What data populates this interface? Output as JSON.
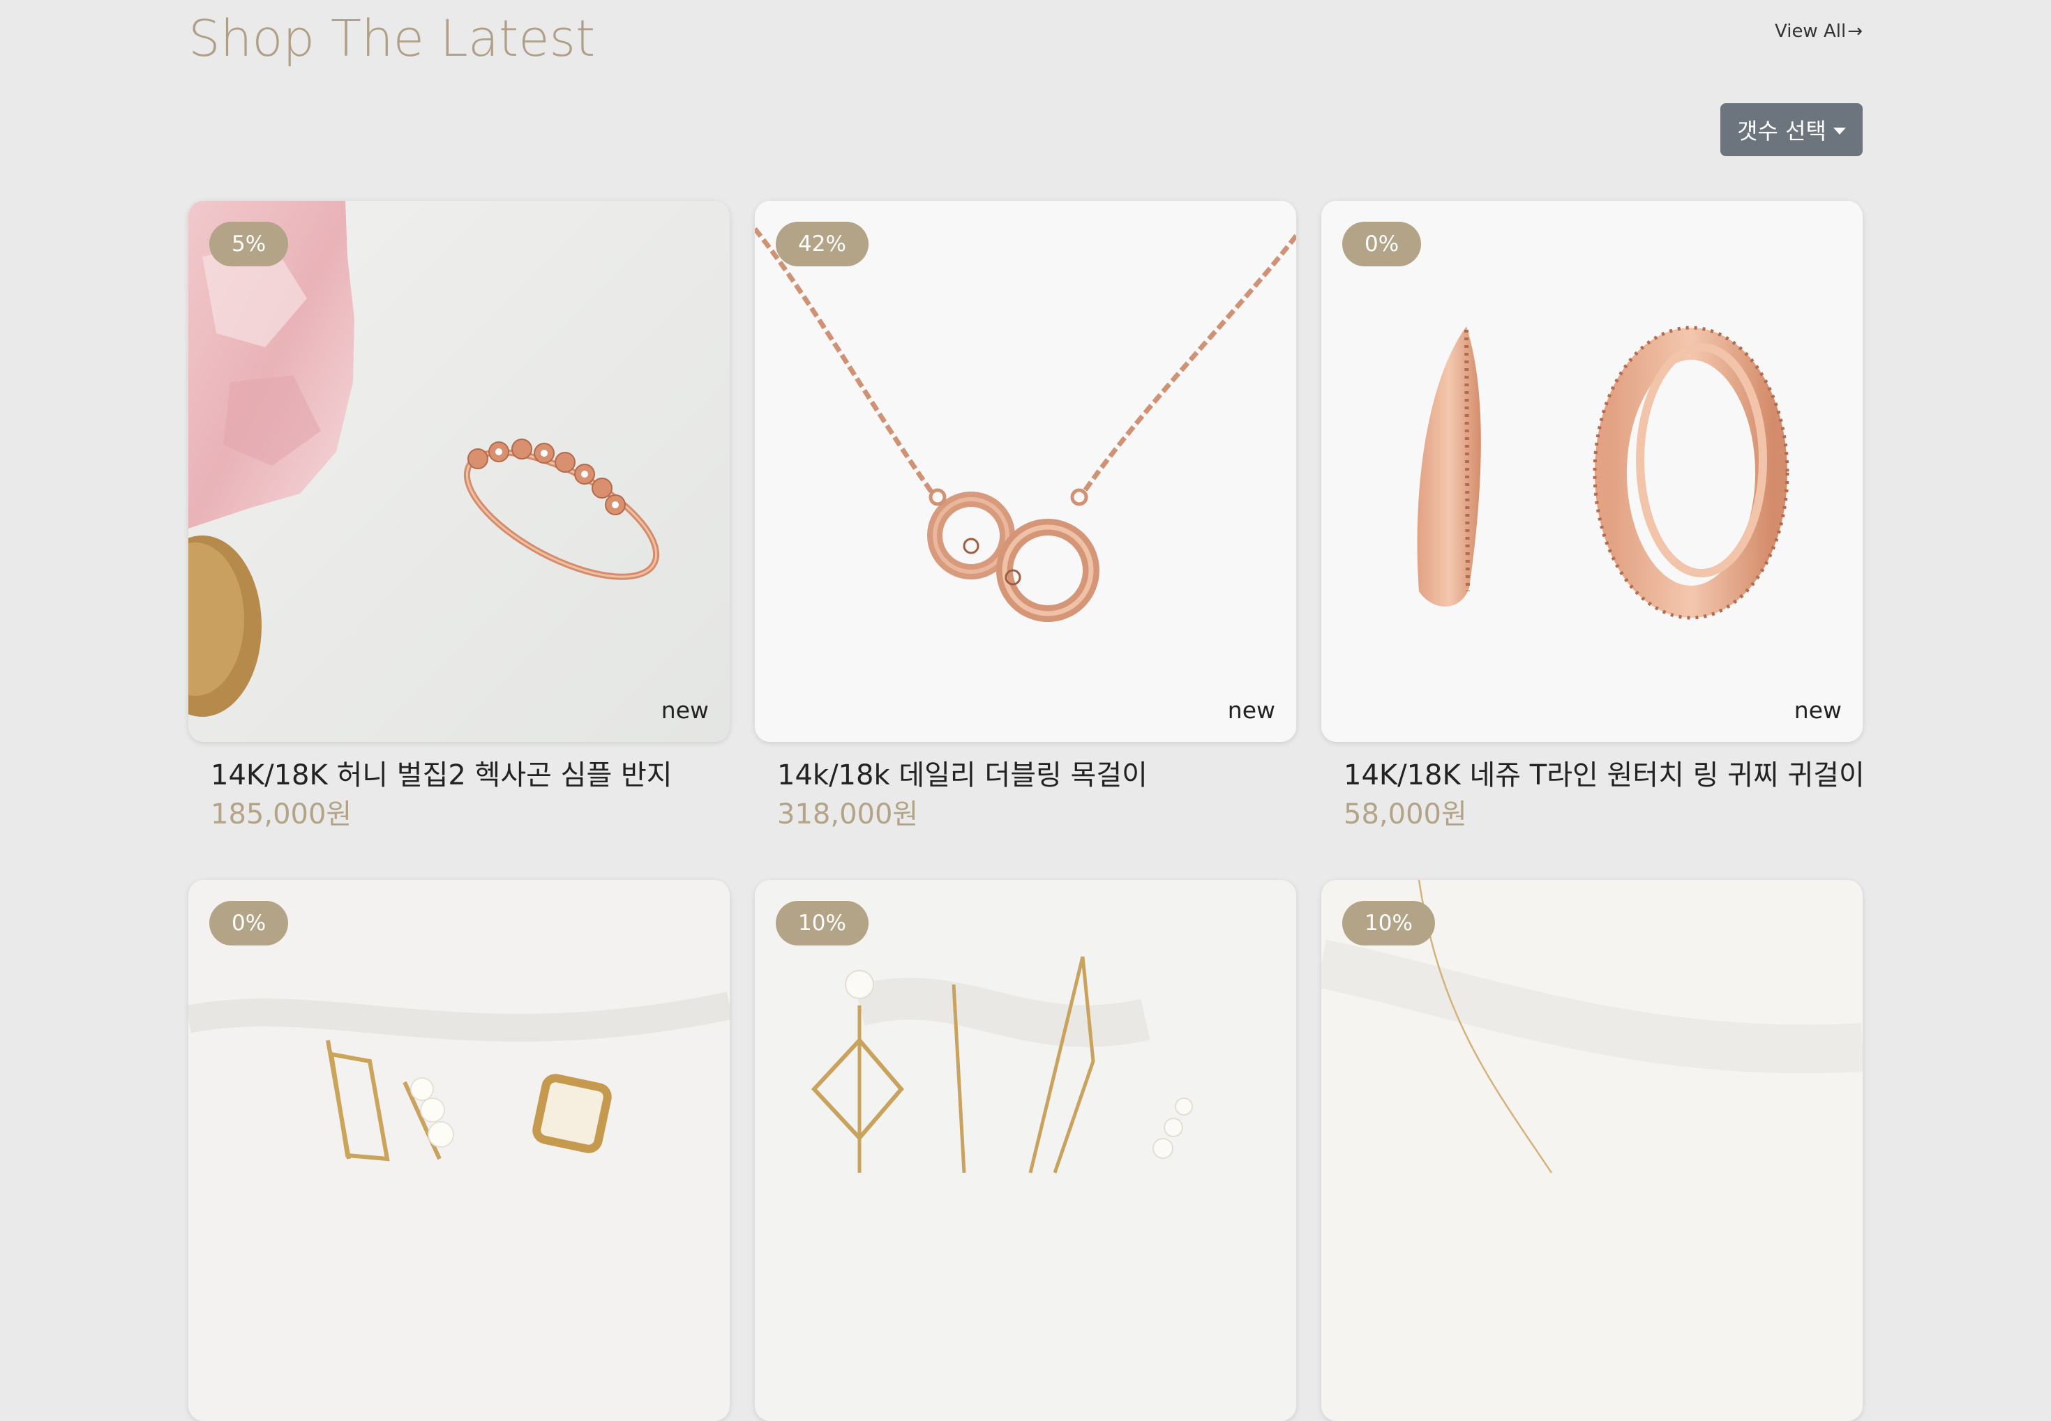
{
  "section": {
    "title": "Shop The Latest",
    "view_all": "View All",
    "arrow": "→",
    "count_select_label": "갯수 선택"
  },
  "products": [
    {
      "discount": "5%",
      "new_label": "new",
      "name": "14K/18K 허니 벌집2 헥사곤 심플 반지",
      "price": "185,000원",
      "image": "rose-gold-ring"
    },
    {
      "discount": "42%",
      "new_label": "new",
      "name": "14k/18k 데일리 더블링 목걸이",
      "price": "318,000원",
      "image": "double-ring-necklace"
    },
    {
      "discount": "0%",
      "new_label": "new",
      "name": "14K/18K 네쥬 T라인 원터치 링 귀찌 귀걸이",
      "price": "58,000원",
      "image": "hoop-earrings"
    },
    {
      "discount": "0%",
      "image": "gold-hairpins-pearls"
    },
    {
      "discount": "10%",
      "image": "gold-hairpins-geometric"
    },
    {
      "discount": "10%",
      "image": "gold-chain-on-fabric"
    }
  ],
  "colors": {
    "accent": "#b3a487",
    "title": "#b09f87",
    "button": "#6c757d",
    "background": "#eaeaea"
  }
}
